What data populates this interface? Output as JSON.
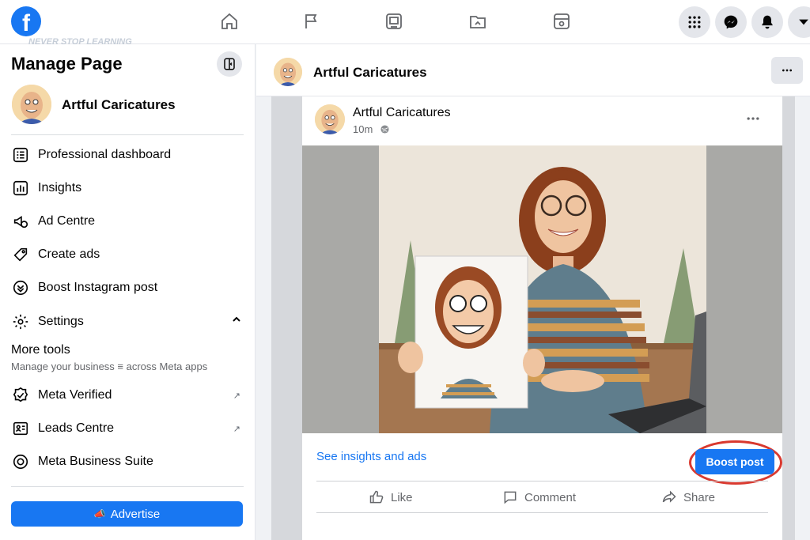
{
  "topbar": {
    "logo_letter": "f",
    "watermark": "NEVER STOP LEARNING",
    "nav_icons": [
      "home-icon",
      "flag-icon",
      "video-icon",
      "marketplace-icon",
      "gaming-icon"
    ],
    "right_icons": [
      "menu-grid-icon",
      "messenger-icon",
      "notifications-icon",
      "account-chevron-icon"
    ]
  },
  "sidebar": {
    "title": "Manage Page",
    "page_name": "Artful Caricatures",
    "items": [
      {
        "label": "Professional dashboard",
        "icon": "dashboard-icon"
      },
      {
        "label": "Insights",
        "icon": "insights-icon"
      },
      {
        "label": "Ad Centre",
        "icon": "ad-centre-icon"
      },
      {
        "label": "Create ads",
        "icon": "create-ads-icon"
      },
      {
        "label": "Boost Instagram post",
        "icon": "boost-instagram-icon"
      },
      {
        "label": "Settings",
        "icon": "settings-icon"
      }
    ],
    "more_tools_title": "More tools",
    "more_tools_subtitle": "Manage your business ≡ across Meta apps",
    "tools": [
      {
        "label": "Meta Verified",
        "icon": "verified-icon",
        "external": "↗"
      },
      {
        "label": "Leads Centre",
        "icon": "leads-icon",
        "external": "↗"
      },
      {
        "label": "Meta Business Suite",
        "icon": "business-suite-icon"
      }
    ],
    "advertise_label": "Advertise"
  },
  "main": {
    "page_name": "Artful Caricatures"
  },
  "post": {
    "author": "Artful Caricatures",
    "time": "10m",
    "insights_link": "See insights and ads",
    "boost_label": "Boost post",
    "actions": [
      {
        "label": "Like",
        "icon": "like-icon"
      },
      {
        "label": "Comment",
        "icon": "comment-icon"
      },
      {
        "label": "Share",
        "icon": "share-icon"
      }
    ]
  },
  "colors": {
    "brand": "#1877f2",
    "highlight_circle": "#d9392f"
  }
}
